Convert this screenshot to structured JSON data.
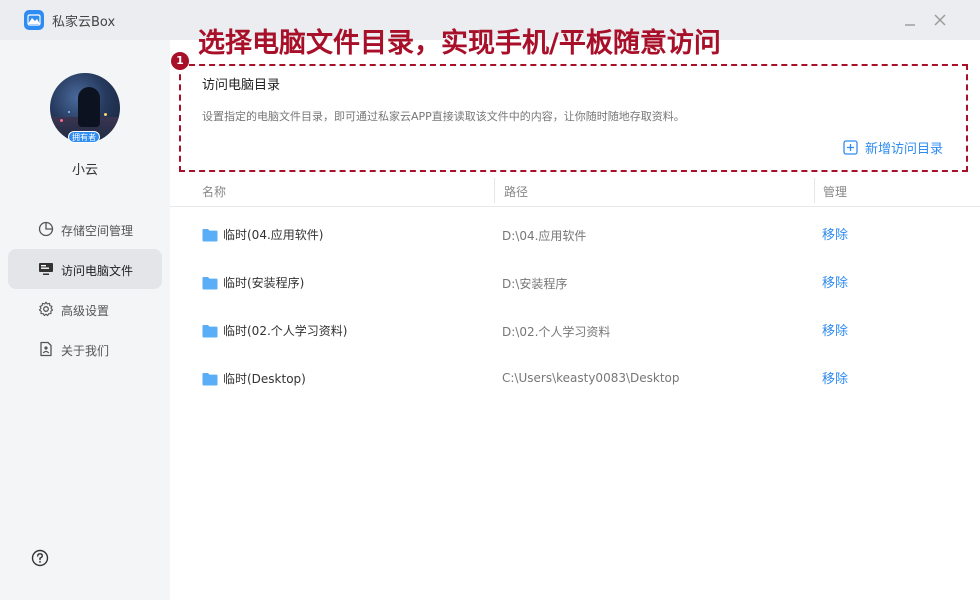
{
  "app": {
    "title": "私家云Box",
    "minimize_icon": "minimize-icon",
    "close_icon": "close-icon"
  },
  "headline": "选择电脑文件目录，实现手机/平板随意访问",
  "step_marker": "1",
  "sidebar": {
    "badge": "拥有者",
    "username": "小云",
    "items": [
      {
        "label": "存储空间管理",
        "icon": "pie-chart-icon",
        "active": false
      },
      {
        "label": "访问电脑文件",
        "icon": "monitor-icon",
        "active": true
      },
      {
        "label": "高级设置",
        "icon": "gear-icon",
        "active": false
      },
      {
        "label": "关于我们",
        "icon": "document-icon",
        "active": false
      }
    ],
    "help_icon": "question-mark-icon"
  },
  "section": {
    "title": "访问电脑目录",
    "description": "设置指定的电脑文件目录，即可通过私家云APP直接读取该文件中的内容，让你随时随地存取资料。",
    "add_label": "新增访问目录"
  },
  "table": {
    "headers": [
      "名称",
      "路径",
      "管理"
    ],
    "rows": [
      {
        "name": "临时(04.应用软件)",
        "path": "D:\\04.应用软件",
        "action": "移除"
      },
      {
        "name": "临时(安装程序)",
        "path": "D:\\安装程序",
        "action": "移除"
      },
      {
        "name": "临时(02.个人学习资料)",
        "path": "D:\\02.个人学习资料",
        "action": "移除"
      },
      {
        "name": "临时(Desktop)",
        "path": "C:\\Users\\keasty0083\\Desktop",
        "action": "移除"
      }
    ]
  },
  "colors": {
    "accent": "#2f8cf0",
    "highlight_red": "#a8102a",
    "folder": "#5aaef5"
  }
}
